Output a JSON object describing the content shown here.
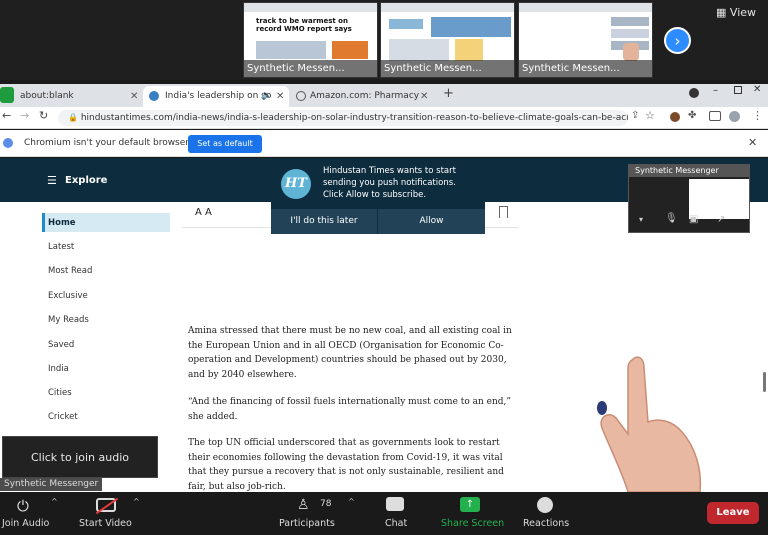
{
  "zoom_top": {
    "thumbnails": [
      {
        "label": "Synthetic Messen...",
        "headline": "track to be warmest on record WMO report says"
      },
      {
        "label": "Synthetic Messen..."
      },
      {
        "label": "Synthetic Messen..."
      }
    ],
    "view_label": "View"
  },
  "browser": {
    "tabs": [
      {
        "title": "about:blank"
      },
      {
        "title": "India's leadership on so"
      },
      {
        "title": "Amazon.com: Pharmacy"
      }
    ],
    "url": "hindustantimes.com/india-news/india-s-leadership-on-solar-industry-transition-reason-to-believe-climate-goals-can-be-achiev",
    "infobar_text": "Chromium isn't your default browser",
    "set_default_label": "Set as default"
  },
  "site": {
    "explore_label": "Explore",
    "sidebar_items": [
      "Home",
      "Latest",
      "Most Read",
      "Exclusive",
      "My Reads",
      "Saved",
      "India",
      "Cities",
      "Cricket"
    ],
    "font_size_label": "A A",
    "paragraphs": [
      "Amina stressed that there must be no new coal, and all existing coal in the European Union and in all OECD (Organisation for Economic Co-operation and Development) countries should be phased out by 2030, and by 2040 elsewhere.",
      "“And the financing of fossil fuels internationally must come to an end,” she added.",
      "The top UN official underscored that as governments look to restart their economies following the devastation from Covid-19, it was vital that they pursue a recovery that is not only sustainable, resilient and fair, but also job-rich."
    ]
  },
  "notification": {
    "logo_text": "HT",
    "message": "Hindustan Times wants to start sending you push notifications. Click Allow to subscribe.",
    "later_label": "I'll do this later",
    "allow_label": "Allow"
  },
  "mini_video": {
    "label": "Synthetic Messenger"
  },
  "self_label": "Synthetic Messenger",
  "join_audio_popup": "Click to join audio",
  "toolbar": {
    "join_audio": "Join Audio",
    "start_video": "Start Video",
    "participants": "Participants",
    "participants_count": "78",
    "chat": "Chat",
    "share_screen": "Share Screen",
    "reactions": "Reactions",
    "leave": "Leave"
  },
  "colors": {
    "ht_navy": "#0d2d3f",
    "zoom_blue": "#2d8cff",
    "share_green": "#22b14c",
    "leave_red": "#c0282e",
    "chrome_blue": "#1a73e8"
  }
}
